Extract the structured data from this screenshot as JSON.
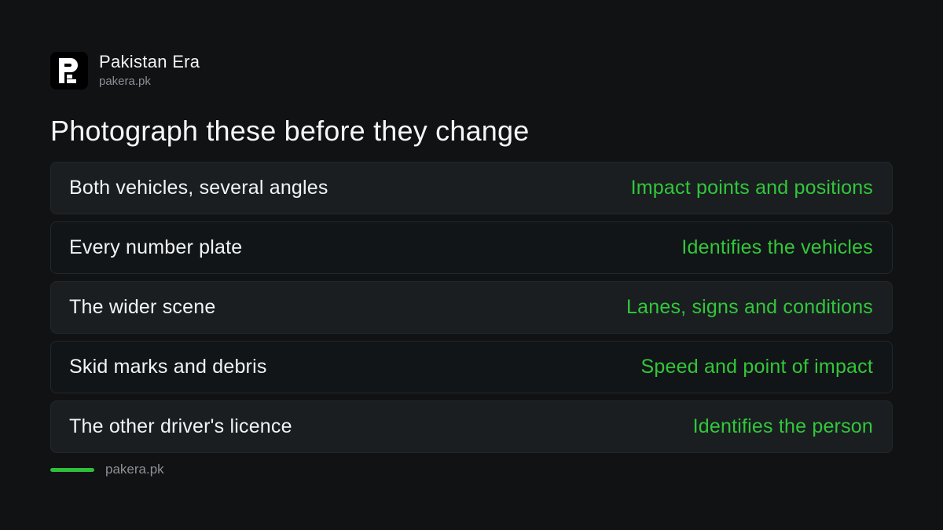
{
  "brand": {
    "name": "Pakistan Era",
    "site": "pakera.pk",
    "logo_icon": "pakera-logo-icon"
  },
  "headline": "Photograph these before they change",
  "items": [
    {
      "label": "Both vehicles, several angles",
      "note": "Impact points and positions"
    },
    {
      "label": "Every number plate",
      "note": "Identifies the vehicles"
    },
    {
      "label": "The wider scene",
      "note": "Lanes, signs and conditions"
    },
    {
      "label": "Skid marks and debris",
      "note": "Speed and point of impact"
    },
    {
      "label": "The other driver's licence",
      "note": "Identifies the person"
    }
  ],
  "footer": {
    "site": "pakera.pk"
  },
  "colors": {
    "background": "#101214",
    "accent": "#2fbf3a",
    "note_text": "#32c73b",
    "row_shaded": "#1a1e21",
    "row_plain": "#121517"
  }
}
